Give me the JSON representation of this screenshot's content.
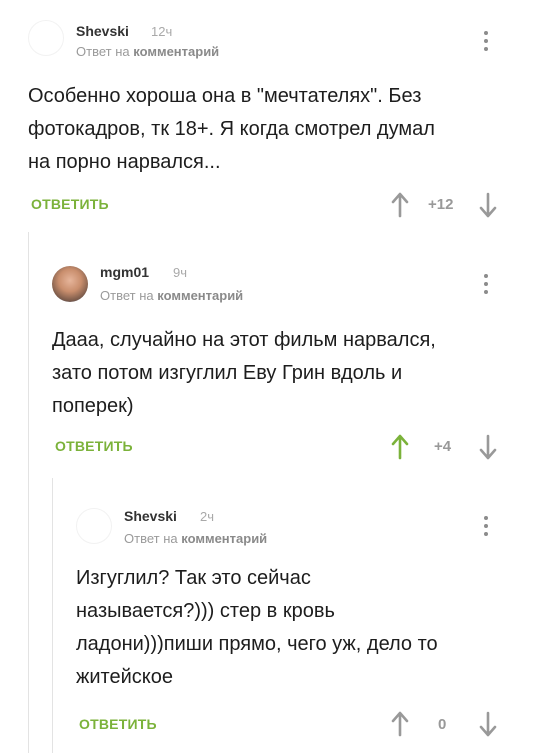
{
  "comments": [
    {
      "author": "Shevski",
      "time": "12ч",
      "reply_prefix": "Ответ на",
      "reply_target": "комментарий",
      "text_lines": [
        "Особенно хороша она в \"мечтателях\". Без",
        "фотокадров, тк 18+. Я когда смотрел думал",
        "на порно нарвался..."
      ],
      "reply_label": "ОТВЕТИТЬ",
      "score": "+12",
      "upvote_color": "#999999",
      "avatar": "blank-avatar"
    },
    {
      "author": "mgm01",
      "time": "9ч",
      "reply_prefix": "Ответ на",
      "reply_target": "комментарий",
      "text_lines": [
        "Дааа, случайно на этот фильм нарвался,",
        "зато потом изгуглил Еву Грин вдоль и",
        "поперек)"
      ],
      "reply_label": "ОТВЕТИТЬ",
      "score": "+4",
      "upvote_color": "#7bb23a",
      "avatar": "photo-avatar"
    },
    {
      "author": "Shevski",
      "time": "2ч",
      "reply_prefix": "Ответ на",
      "reply_target": "комментарий",
      "text_lines": [
        "Изгуглил? Так это сейчас",
        "называется?))) стер в кровь",
        "ладони)))пиши прямо, чего уж, дело то",
        "житейское"
      ],
      "reply_label": "ОТВЕТИТЬ",
      "score": "0",
      "upvote_color": "#999999",
      "avatar": "blank-avatar"
    }
  ],
  "colors": {
    "accent_green": "#7bb23a",
    "muted": "#999999",
    "thread_line": "#e3e3e3"
  },
  "icons": [
    "upvote-arrow-icon",
    "downvote-arrow-icon",
    "more-options-icon"
  ]
}
